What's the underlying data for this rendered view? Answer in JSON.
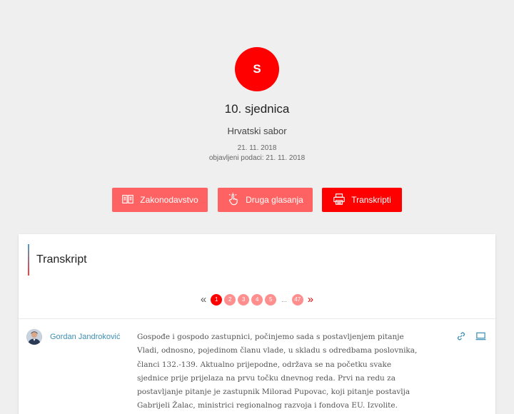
{
  "session": {
    "logo_letter": "S",
    "title": "10. sjednica",
    "body": "Hrvatski sabor",
    "date": "21. 11. 2018",
    "published": "objavljeni podaci: 21. 11. 2018"
  },
  "actions": {
    "zakonodavstvo": "Zakonodavstvo",
    "glasanja": "Druga glasanja",
    "transkripti": "Transkripti"
  },
  "transcript": {
    "title": "Transkript",
    "pagination": {
      "prev": "«",
      "pages": [
        "1",
        "2",
        "3",
        "4",
        "5"
      ],
      "ellipsis": "...",
      "last": "47",
      "next": "»"
    },
    "entry": {
      "speaker": "Gordan Jandroković",
      "text": "Gospođe i gospodo zastupnici, počinjemo sada s postavljenjem pitanje Vladi, odnosno, pojedinom članu vlade, u skladu s odredbama poslovnika, članci 132.-139. Aktualno prijepodne, održava se na početku svake sjednice prije prijelaza na prvu točku dnevnog reda. Prvi na redu za postavljanje pitanje je zastupnik Milorad Pupovac, koji pitanje postavlja Gabrijeli Žalac, ministrici regionalnog razvoja i fondova EU. Izvolite."
    }
  },
  "icons": [
    "book-icon",
    "hand-pointer-icon",
    "printer-icon",
    "link-icon",
    "screen-icon"
  ],
  "colors": {
    "primary": "#ff0000",
    "secondary": "#ff6262",
    "link": "#3d8fb5"
  }
}
